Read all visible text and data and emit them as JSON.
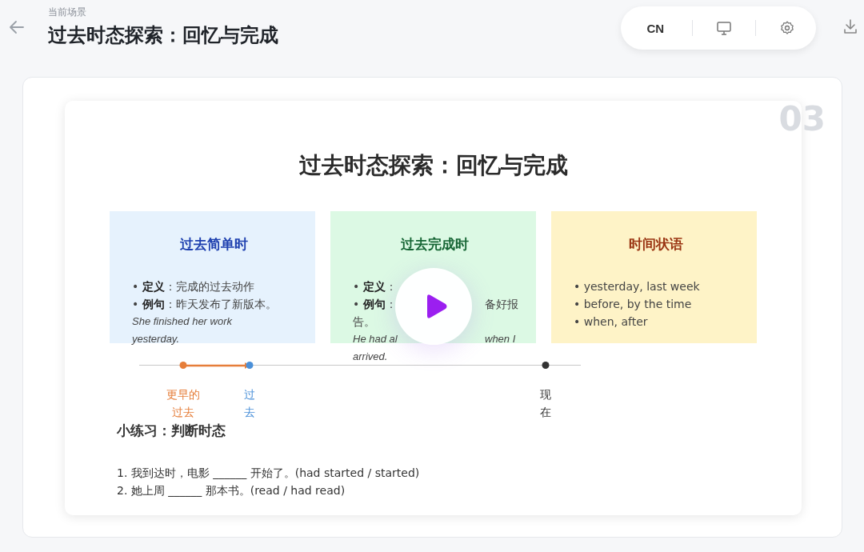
{
  "header": {
    "caption": "当前场景",
    "title": "过去时态探索：回忆与完成"
  },
  "toolbar": {
    "language": "CN"
  },
  "slide": {
    "number": "03",
    "title": "过去时态探索：回忆与完成",
    "cards": [
      {
        "kind": "def",
        "title": "过去简单时",
        "color": "#1e40af",
        "rows": [
          [
            "• **定义**：完成的过去动作"
          ],
          [
            "• **例句**：昨天发布了新版本。"
          ]
        ],
        "sentence": [
          [
            "She finished her work"
          ],
          [
            "yesterday."
          ]
        ]
      },
      {
        "kind": "def",
        "title": "过去完成时",
        "color": "#166534",
        "rows": [
          [
            "• **定义**："
          ],
          [
            "• **例句**：",
            "备好报"
          ],
          [
            "告。"
          ]
        ],
        "sentence": [
          [
            "He had al",
            "when I"
          ],
          [
            "arrived."
          ]
        ]
      },
      {
        "kind": "list",
        "title": "时间状语",
        "color": "#9a3412",
        "lines": [
          "• yesterday, last week",
          "• before, by the time",
          "• when, after"
        ]
      }
    ],
    "timeline": [
      {
        "label": "更早的过去",
        "color": "#e67e3a"
      },
      {
        "label": "过去",
        "color": "#4a90d9"
      },
      {
        "label": "现在",
        "color": "#333333"
      }
    ],
    "practice": {
      "title": "小练习：判断时态",
      "questions": [
        "1. 我到达时，电影 ______ 开始了。(had started / started)",
        "2. 她上周 ______ 那本书。(read / had read)"
      ]
    }
  }
}
